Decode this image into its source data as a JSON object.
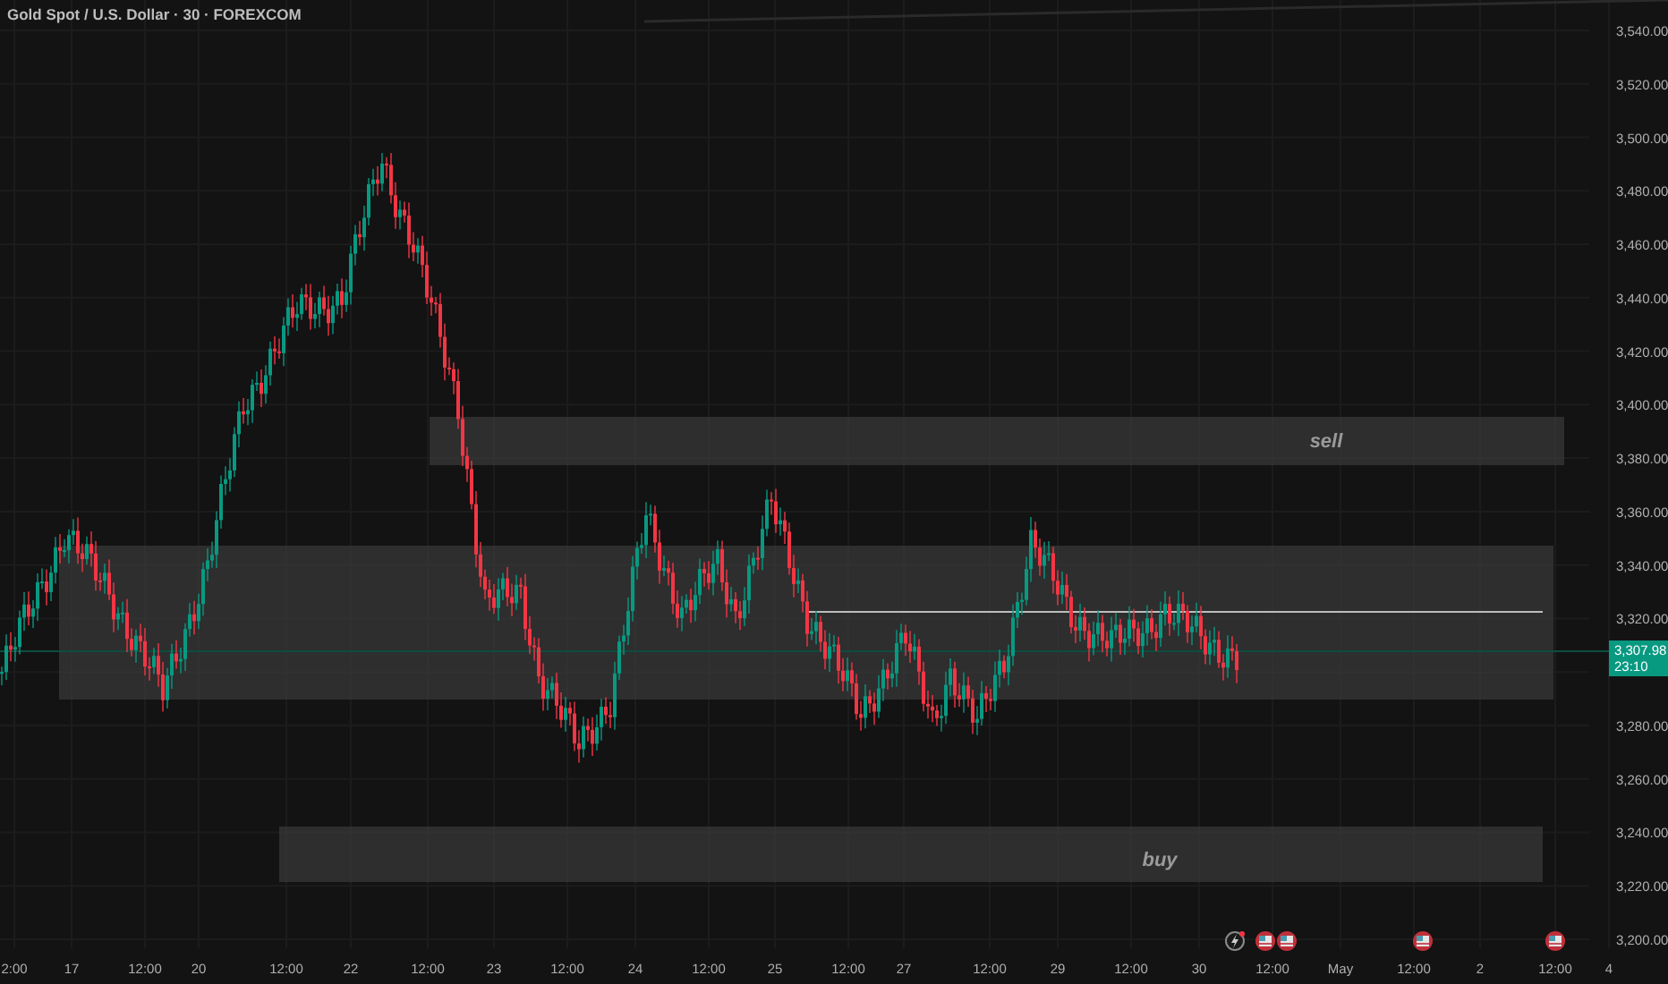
{
  "chart_title": "Gold Spot / U.S. Dollar · 30 · FOREXCOM",
  "price_axis": [
    "3,540.00",
    "3,520.00",
    "3,500.00",
    "3,480.00",
    "3,460.00",
    "3,440.00",
    "3,420.00",
    "3,400.00",
    "3,380.00",
    "3,360.00",
    "3,340.00",
    "3,320.00",
    "3,280.00",
    "3,260.00",
    "3,240.00",
    "3,220.00",
    "3,200.00"
  ],
  "time_axis": [
    "2:00",
    "17",
    "12:00",
    "20",
    "12:00",
    "22",
    "12:00",
    "23",
    "12:00",
    "24",
    "12:00",
    "25",
    "12:00",
    "27",
    "12:00",
    "29",
    "12:00",
    "30",
    "12:00",
    "May",
    "12:00",
    "2",
    "12:00",
    "4"
  ],
  "zones": [
    {
      "kind": "rectangle",
      "label": "sell"
    },
    {
      "kind": "rectangle"
    },
    {
      "kind": "rectangle",
      "label": "buy"
    }
  ],
  "price_tag": {
    "price": "3,307.98",
    "countdown": "23:10"
  }
}
